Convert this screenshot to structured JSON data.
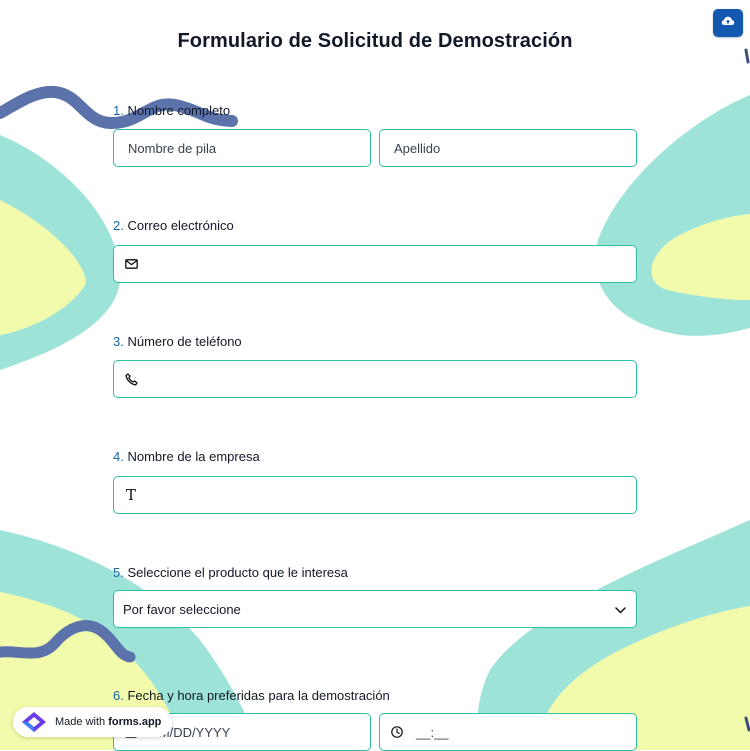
{
  "form": {
    "title": "Formulario de Solicitud de Demostración",
    "questions": [
      {
        "num": "1.",
        "label": "Nombre completo",
        "first_placeholder": "Nombre de pila",
        "last_placeholder": "Apellido"
      },
      {
        "num": "2.",
        "label": "Correo electrónico",
        "icon": "mail-icon"
      },
      {
        "num": "3.",
        "label": "Número de teléfono",
        "icon": "phone-icon"
      },
      {
        "num": "4.",
        "label": "Nombre de la empresa",
        "icon": "text-t-icon",
        "icon_glyph": "T"
      },
      {
        "num": "5.",
        "label": "Seleccione el producto que le interesa",
        "selected": "Por favor seleccione"
      },
      {
        "num": "6.",
        "label": "Fecha y hora preferidas para la demostración",
        "date_placeholder": "MM/DD/YYYY",
        "time_placeholder": "__:__"
      }
    ]
  },
  "toolbar": {
    "save_icon": "cloud-upload-icon"
  },
  "badge": {
    "prefix": "Made with ",
    "brand": "forms.app"
  },
  "colors": {
    "accent_border": "#2ebfa5",
    "number": "#1a66a8",
    "save_button": "#1558b0",
    "teal_shape": "#9ee3d8",
    "yellow_shape": "#f2fbab",
    "squiggle": "#5b73aa"
  }
}
